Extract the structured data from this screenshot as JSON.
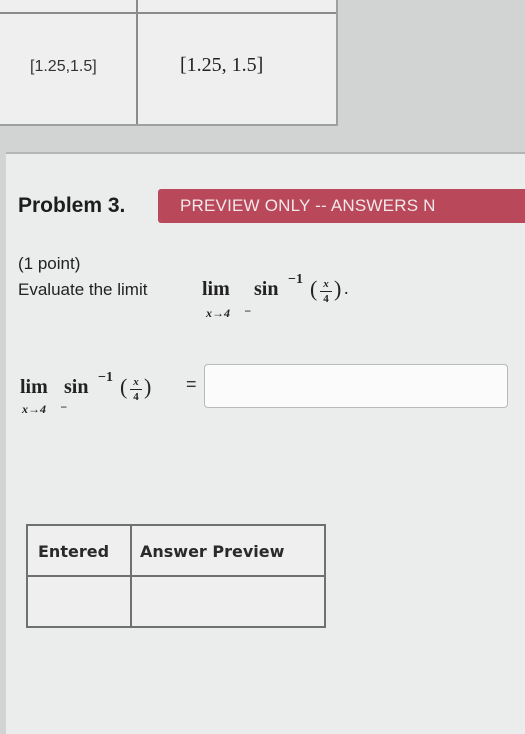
{
  "previous_answer": {
    "entered": "[1.25,1.5]",
    "preview": "[1.25, 1.5]"
  },
  "problem": {
    "title": "Problem 3.",
    "banner": "PREVIEW ONLY -- ANSWERS N",
    "points": "(1 point)",
    "prompt": "Evaluate the limit",
    "limit_word": "lim",
    "limit_sub": "x→4",
    "minus_sup": "−",
    "function": "sin",
    "exponent": "−1",
    "frac_num": "x",
    "frac_den": "4",
    "open_paren": "(",
    "close_paren": ")",
    "period": "."
  },
  "answer": {
    "lim": "lim",
    "sub": "x→4",
    "minus_sup": "−",
    "function": "sin",
    "exponent": "−1",
    "frac_num": "x",
    "frac_den": "4",
    "open_paren": "(",
    "close_paren": ")",
    "equals": "=",
    "value": ""
  },
  "preview_table": {
    "headers": [
      "Entered",
      "Answer Preview"
    ],
    "rows": [
      [
        "",
        ""
      ]
    ]
  }
}
